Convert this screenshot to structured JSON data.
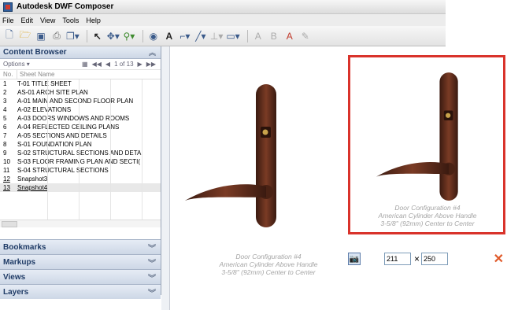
{
  "window": {
    "title": "Autodesk DWF Composer"
  },
  "menu": [
    "File",
    "Edit",
    "View",
    "Tools",
    "Help"
  ],
  "content_browser": {
    "title": "Content Browser",
    "options_label": "Options ▾",
    "pager_text": "1 of 13",
    "col_no": "No.",
    "col_name": "Sheet Name",
    "sheets": [
      {
        "no": "1",
        "name": "T-01 TITLE SHEET"
      },
      {
        "no": "2",
        "name": "AS-01 ARCH SITE PLAN"
      },
      {
        "no": "3",
        "name": "A-01 MAIN AND SECOND FLOOR PLAN"
      },
      {
        "no": "4",
        "name": "A-02 ELEVATIONS"
      },
      {
        "no": "5",
        "name": "A-03 DOORS WINDOWS AND ROOMS"
      },
      {
        "no": "6",
        "name": "A-04 REFLECTED CEILING PLANS"
      },
      {
        "no": "7",
        "name": "A-05 SECTIONS AND DETAILS"
      },
      {
        "no": "8",
        "name": "S-01 FOUNDATION PLAN"
      },
      {
        "no": "9",
        "name": "S-02 STRUCTURAL SECTIONS AND DETA"
      },
      {
        "no": "10",
        "name": "S-03 FLOOR FRAMING PLAN AND SECTI("
      },
      {
        "no": "11",
        "name": "S-04 STRUCTURAL SECTIONS"
      },
      {
        "no": "12",
        "name": "Snapshot3"
      },
      {
        "no": "13",
        "name": "Snapshot4"
      }
    ]
  },
  "panels": [
    "Bookmarks",
    "Markups",
    "Views",
    "Layers"
  ],
  "viewer_caption": {
    "line1": "Door Configuration #4",
    "line2": "American Cylinder Above Handle",
    "line3": "3-5/8\" (92mm) Center to Center"
  },
  "snapshot": {
    "width": "211",
    "height": "250",
    "times_symbol": "×"
  },
  "colors": {
    "highlight_border": "#d9332b",
    "handle_bronze": "#5a2b1c"
  }
}
